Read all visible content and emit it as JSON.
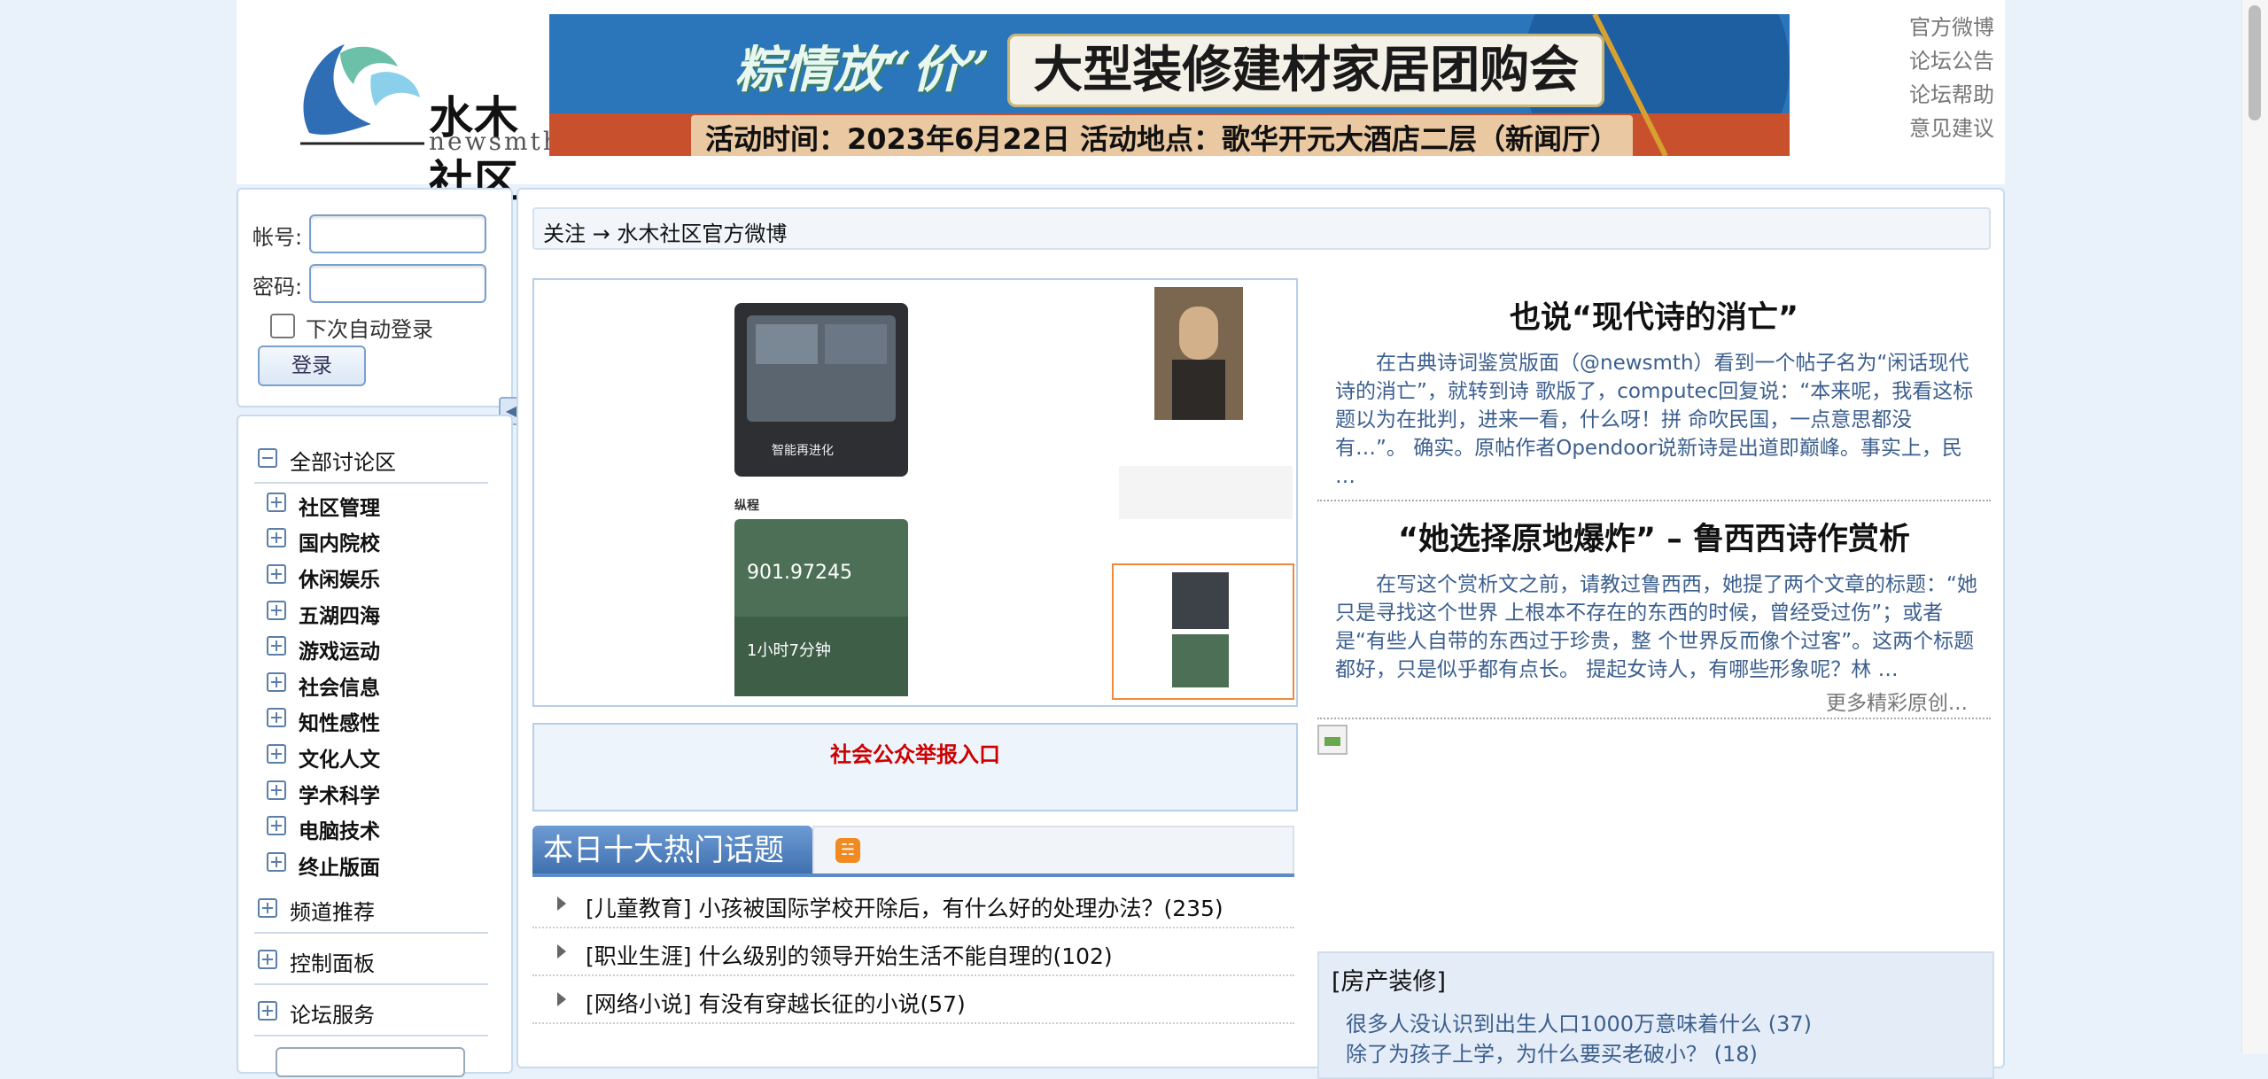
{
  "header": {
    "logo_title": "水木社区",
    "logo_subtitle": "newsmth.net",
    "banner": {
      "prefix": "粽情放“价”",
      "title": "大型装修建材家居团购会",
      "subtitle": "活动时间：2023年6月22日    活动地点：歌华开元大酒店二层（新闻厅）"
    },
    "top_links": [
      "官方微博",
      "论坛公告",
      "论坛帮助",
      "意见建议"
    ]
  },
  "login": {
    "account_label": "帐号:",
    "password_label": "密码:",
    "auto_login_label": "下次自动登录",
    "login_button": "登录"
  },
  "nav": {
    "all_sections": "全部讨论区",
    "sections": [
      "社区管理",
      "国内院校",
      "休闲娱乐",
      "五湖四海",
      "游戏运动",
      "社会信息",
      "知性感性",
      "文化人文",
      "学术科学",
      "电脑技术",
      "终止版面"
    ],
    "channel": "频道推荐",
    "control": "控制面板",
    "service": "论坛服务"
  },
  "main": {
    "breadcrumb": "关注 → 水木社区官方微博",
    "report_link": "社会公众举报入口",
    "hot": {
      "tab_title": "本日十大热门话题",
      "rss_icon": "rss-icon",
      "topics": [
        "[儿童教育] 小孩被国际学校开除后，有什么好的处理办法？(235)",
        "[职业生涯] 什么级别的领导开始生活不能自理的(102)",
        "[网络小说] 有没有穿越长征的小说(57)"
      ]
    },
    "slideshow": {
      "img_text_1": "智能再进化",
      "img_text_2": "纵程",
      "img_text_3": "901.97245",
      "img_text_4": "1小时7分钟"
    },
    "articles": [
      {
        "title": "也说“现代诗的消亡”",
        "body": "在古典诗词鉴赏版面（@newsmth）看到一个帖子名为“闲话现代诗的消亡”，就转到诗 歌版了，computec回复说：“本来呢，我看这标题以为在批判，进来一看，什么呀！拼 命吹民国，一点意思都没有…”。 确实。原帖作者Opendoor说新诗是出道即巅峰。事实上，民 …"
      },
      {
        "title": "“她选择原地爆炸” – 鲁西西诗作赏析",
        "body": "在写这个赏析文之前，请教过鲁西西，她提了两个文章的标题：“她只是寻找这个世界 上根本不存在的东西的时候，曾经受过伤”；或者是“有些人自带的东西过于珍贵，整 个世界反而像个过客”。这两个标题都好，只是似乎都有点长。 提起女诗人，有哪些形象呢？林 …"
      }
    ],
    "more_link": "更多精彩原创...",
    "estate": {
      "title": "[房产装修]",
      "links": [
        "很多人没认识到出生人口1000万意味着什么 (37)",
        "除了为孩子上学，为什么要买老破小？ (18)"
      ]
    }
  }
}
